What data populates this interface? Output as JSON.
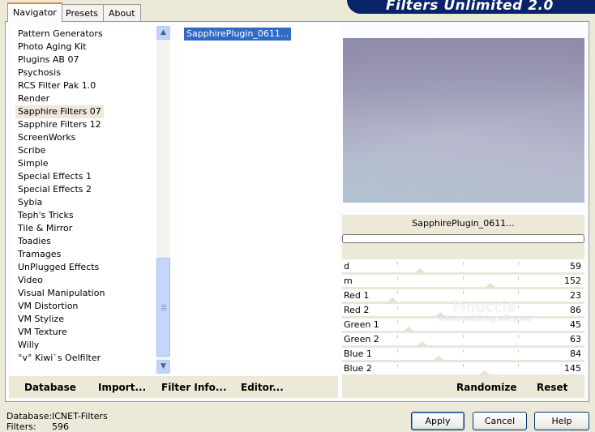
{
  "tabs": [
    "Navigator",
    "Presets",
    "About"
  ],
  "banner_title": "Filters Unlimited 2.0",
  "categories": [
    "Pattern Generators",
    "Photo Aging Kit",
    "Plugins AB 07",
    "Psychosis",
    "RCS Filter Pak 1.0",
    "Render",
    "Sapphire Filters 07",
    "Sapphire Filters 12",
    "ScreenWorks",
    "Scribe",
    "Simple",
    "Special Effects 1",
    "Special Effects 2",
    "Sybia",
    "Teph's Tricks",
    "Tile & Mirror",
    "Toadies",
    "Tramages",
    "UnPlugged Effects",
    "Video",
    "Visual Manipulation",
    "VM Distortion",
    "VM Stylize",
    "VM Texture",
    "Willy",
    "°v° Kiwi`s Oelfilter"
  ],
  "selected_category": "Sapphire Filters 07",
  "filters": [
    "SapphirePlugin_0611..."
  ],
  "selected_filter_name": "SapphirePlugin_0611...",
  "parameters": [
    {
      "label": "d",
      "value": "59"
    },
    {
      "label": "m",
      "value": "152"
    },
    {
      "label": "Red 1",
      "value": "23"
    },
    {
      "label": "Red 2",
      "value": "86"
    },
    {
      "label": "Green 1",
      "value": "45"
    },
    {
      "label": "Green 2",
      "value": "63"
    },
    {
      "label": "Blue 1",
      "value": "84"
    },
    {
      "label": "Blue 2",
      "value": "145"
    }
  ],
  "left_buttons": {
    "database": "Database",
    "import": "Import...",
    "filter_info": "Filter Info...",
    "editor": "Editor..."
  },
  "right_buttons": {
    "randomize": "Randomize",
    "reset": "Reset"
  },
  "watermark": {
    "line1": "Pinuccia",
    "line2": "www.maidiregrafica.eu"
  },
  "status": {
    "database_label": "Database:",
    "database_value": "ICNET-Filters",
    "filters_label": "Filters:",
    "filters_value": "596"
  },
  "dialog_buttons": {
    "apply": "Apply",
    "cancel": "Cancel",
    "help": "Help"
  },
  "colors": {
    "selection": "#316ac5",
    "banner": "#0a246a",
    "window": "#ece9d8"
  }
}
